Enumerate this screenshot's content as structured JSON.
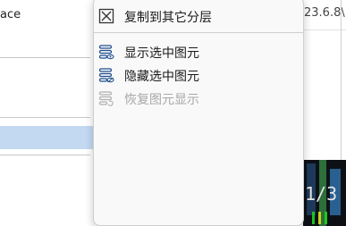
{
  "background": {
    "left_title": "ace",
    "right_path": "23.6.8\\"
  },
  "context_menu": {
    "items": [
      {
        "label": "复制到其它分层",
        "icon": "copy-to-layer-icon",
        "enabled": true
      },
      {
        "label": "显示选中图元",
        "icon": "show-element-icon",
        "enabled": true
      },
      {
        "label": "隐藏选中图元",
        "icon": "hide-element-icon",
        "enabled": true
      },
      {
        "label": "恢复图元显示",
        "icon": "restore-element-icon",
        "enabled": false
      }
    ]
  },
  "thumbnail": {
    "text": "1/3"
  },
  "colors": {
    "menu_bg": "#f9f9f9",
    "icon_blue": "#1f4e8c",
    "disabled_text": "#a8a8a8",
    "selection": "#c3d9f2"
  }
}
